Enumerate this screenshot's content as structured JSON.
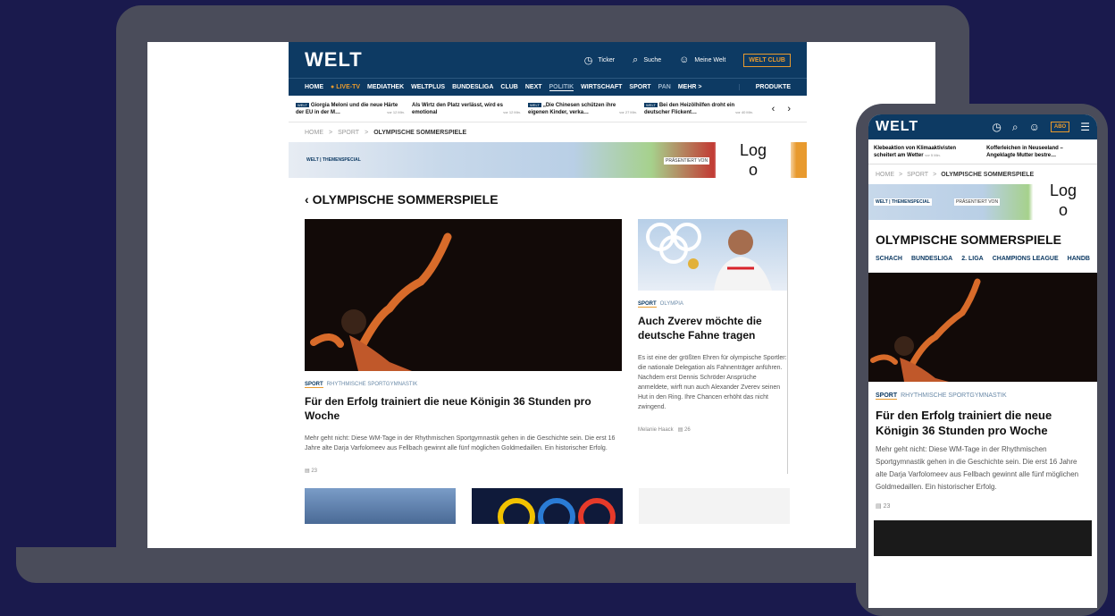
{
  "desktop": {
    "logo": "WELT",
    "topbar": {
      "ticker": "Ticker",
      "search": "Suche",
      "account": "Meine Welt",
      "club": "WELT CLUB"
    },
    "nav": {
      "items": [
        "HOME",
        "LIVE-TV",
        "MEDIATHEK",
        "WELTPLUS",
        "BUNDESLIGA",
        "CLUB",
        "NEXT",
        "POLITIK",
        "WIRTSCHAFT",
        "SPORT",
        "PAN",
        "MEHR >"
      ],
      "produkte": "PRODUKTE"
    },
    "ticker": [
      {
        "text": "Giorgia Meloni und die neue Härte der EU in der M…",
        "time": "vor 12 Min."
      },
      {
        "text": "Als Wirtz den Platz verlässt, wird es emotional",
        "time": "vor 12 Min."
      },
      {
        "text": "„Die Chinesen schützen ihre eigenen Kinder, verka…",
        "time": "vor 27 Min."
      },
      {
        "text": "Bei den Heizölhilfen droht ein deutscher Flickent…",
        "time": "vor 40 Min."
      }
    ],
    "breadcrumb": {
      "home": "HOME",
      "sep": ">",
      "sport": "SPORT",
      "current": "OLYMPISCHE SOMMERSPIELE"
    },
    "banner": {
      "tag": "WELT | THEMENSPECIAL",
      "presents": "PRÄSENTIERT VON",
      "logo": "Logo"
    },
    "section_title": "OLYMPISCHE SOMMERSPIELE",
    "main_article": {
      "kicker": "SPORT",
      "subkicker": "RHYTHMISCHE SPORTGYMNASTIK",
      "headline": "Für den Erfolg trainiert die neue Königin 36 Stunden pro Woche",
      "teaser": "Mehr geht nicht: Diese WM-Tage in der Rhythmischen Sportgymnastik gehen in die Geschichte sein. Die erst 16 Jahre alte Darja Varfolomeev aus Fellbach gewinnt alle fünf möglichen Goldmedaillen. Ein historischer Erfolg.",
      "comments": "23"
    },
    "side_article": {
      "kicker": "SPORT",
      "subkicker": "OLYMPIA",
      "headline": "Auch Zverev möchte die deutsche Fahne tragen",
      "teaser": "Es ist eine der größten Ehren für olympische Sportler: die nationale Delegation als Fahnenträger anführen. Nachdem erst Dennis Schröder Ansprüche anmeldete, wirft nun auch Alexander Zverev seinen Hut in den Ring. Ihre Chancen erhöht das nicht zwingend.",
      "author": "Melanie Haack",
      "comments": "26"
    }
  },
  "mobile": {
    "logo": "WELT",
    "abo": "ABO",
    "ticker": [
      {
        "text": "Klebeaktion von Klimaaktivisten scheitert am Wetter",
        "time": "vor 5 Min."
      },
      {
        "text": "Kofferleichen in Neuseeland – Angeklagte Mutter bestre…",
        "time": ""
      }
    ],
    "breadcrumb": {
      "home": "HOME",
      "sep": ">",
      "sport": "SPORT",
      "current": "OLYMPISCHE SOMMERSPIELE"
    },
    "banner": {
      "tag": "WELT | THEMENSPECIAL",
      "presents": "PRÄSENTIERT VON",
      "logo": "Logo"
    },
    "section_title": "OLYMPISCHE SOMMERSPIELE",
    "tabs": [
      "SCHACH",
      "BUNDESLIGA",
      "2. LIGA",
      "CHAMPIONS LEAGUE",
      "HANDB"
    ],
    "article": {
      "kicker": "SPORT",
      "subkicker": "RHYTHMISCHE SPORTGYMNASTIK",
      "headline": "Für den Erfolg trainiert die neue Königin 36 Stunden pro Woche",
      "teaser": "Mehr geht nicht: Diese WM-Tage in der Rhythmischen Sportgymnastik gehen in die Geschichte sein. Die erst 16 Jahre alte Darja Varfolomeev aus Fellbach gewinnt alle fünf möglichen Goldmedaillen. Ein historischer Erfolg.",
      "comments": "23"
    }
  }
}
